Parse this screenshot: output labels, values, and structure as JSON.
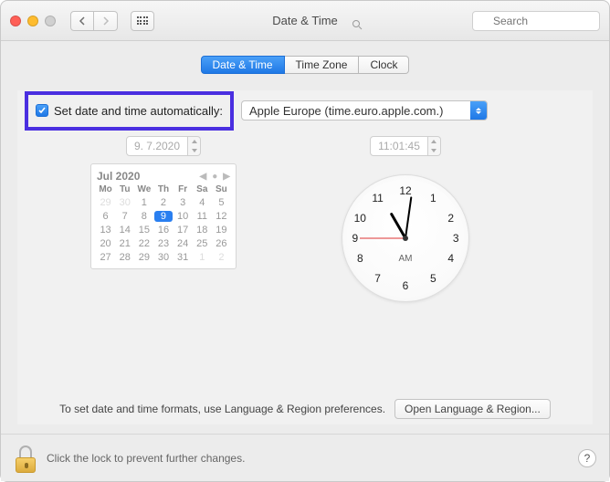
{
  "window": {
    "title": "Date & Time",
    "search_placeholder": "Search"
  },
  "tabs": {
    "date_time": "Date & Time",
    "time_zone": "Time Zone",
    "clock": "Clock"
  },
  "auto": {
    "label": "Set date and time automatically:",
    "server": "Apple Europe (time.euro.apple.com.)"
  },
  "date_field": "9.  7.2020",
  "time_field": "11:01:45",
  "calendar": {
    "month_label": "Jul 2020",
    "dow": [
      "Mo",
      "Tu",
      "We",
      "Th",
      "Fr",
      "Sa",
      "Su"
    ],
    "leading": [
      "29",
      "30"
    ],
    "days": [
      "1",
      "2",
      "3",
      "4",
      "5",
      "6",
      "7",
      "8",
      "9",
      "10",
      "11",
      "12",
      "13",
      "14",
      "15",
      "16",
      "17",
      "18",
      "19",
      "20",
      "21",
      "22",
      "23",
      "24",
      "25",
      "26",
      "27",
      "28",
      "29",
      "30",
      "31"
    ],
    "trailing": [
      "1",
      "2"
    ],
    "selected": "9"
  },
  "clock": {
    "ampm": "AM",
    "numbers": {
      "n12": "12",
      "n1": "1",
      "n2": "2",
      "n3": "3",
      "n4": "4",
      "n5": "5",
      "n6": "6",
      "n7": "7",
      "n8": "8",
      "n9": "9",
      "n10": "10",
      "n11": "11"
    }
  },
  "hint": {
    "text": "To set date and time formats, use Language & Region preferences.",
    "button": "Open Language & Region..."
  },
  "footer": {
    "text": "Click the lock to prevent further changes.",
    "help": "?"
  }
}
